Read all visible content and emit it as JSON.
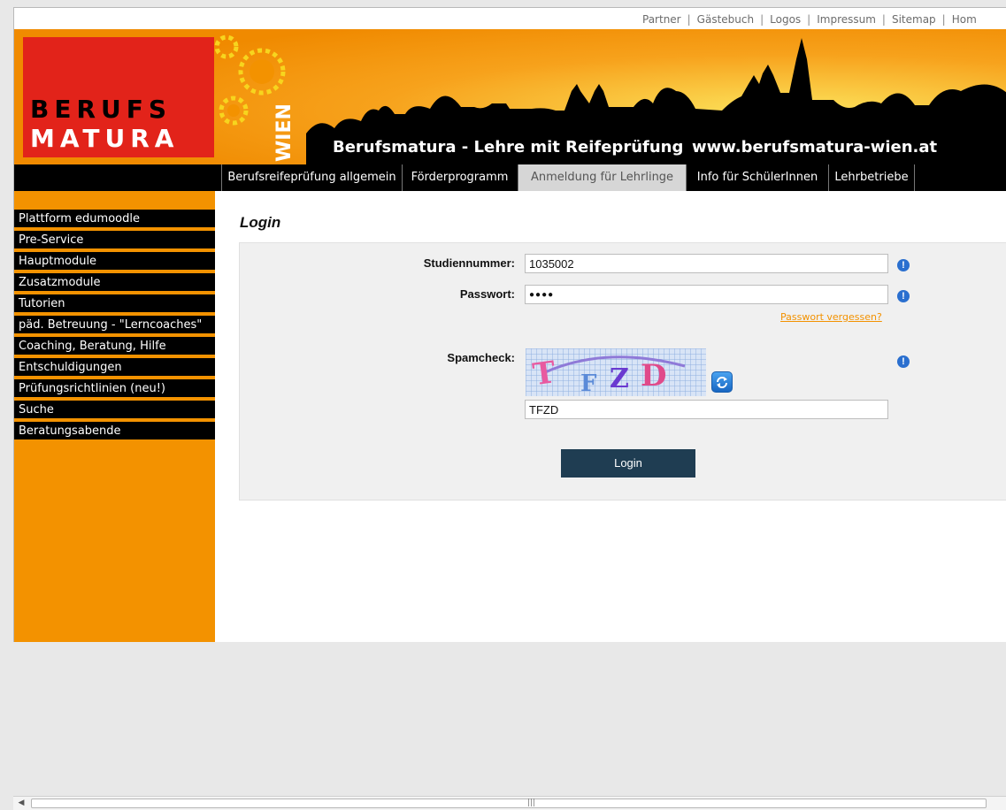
{
  "top_links": [
    "Partner",
    "Gästebuch",
    "Logos",
    "Impressum",
    "Sitemap",
    "Hom"
  ],
  "banner": {
    "logo_line1": "BERUFS",
    "logo_line2": "MATURA",
    "city": "WIEN",
    "tagline": "Berufsmatura - Lehre mit Reifeprüfung",
    "url": "www.berufsmatura-wien.at"
  },
  "nav": {
    "items": [
      "Berufsreifeprüfung allgemein",
      "Förderprogramm",
      "Anmeldung für Lehrlinge",
      "Info für SchülerInnen",
      "Lehrbetriebe"
    ],
    "active": "Anmeldung für Lehrlinge"
  },
  "sidebar": {
    "items": [
      "Plattform edumoodle",
      "Pre-Service",
      "Hauptmodule",
      "Zusatzmodule",
      "Tutorien",
      "päd. Betreuung - \"Lerncoaches\"",
      "Coaching, Beratung, Hilfe",
      "Entschuldigungen",
      "Prüfungsrichtlinien (neu!)",
      "Suche",
      "Beratungsabende"
    ]
  },
  "login": {
    "title": "Login",
    "student_label": "Studiennummer:",
    "student_value": "1035002",
    "password_label": "Passwort:",
    "password_value": "●●●●",
    "forgot_label": "Passwort vergessen?",
    "spam_label": "Spamcheck:",
    "captcha_text": "TFZD",
    "spam_value": "TFZD",
    "button_label": "Login"
  },
  "colors": {
    "orange": "#f39200",
    "red": "#e2231a",
    "navbar": "#000000",
    "button": "#1f3d52",
    "info": "#2a6fcf"
  },
  "icons": [
    "info-icon",
    "refresh-icon",
    "gear-icon",
    "scroll-left-icon"
  ]
}
